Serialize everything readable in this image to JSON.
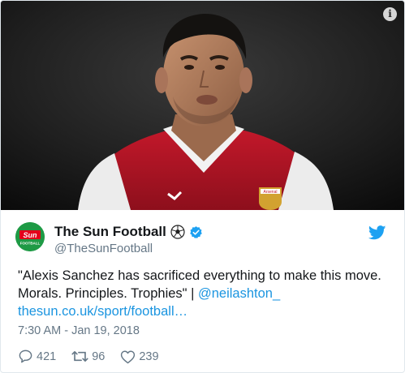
{
  "media": {
    "description_icon": "info-icon",
    "info_label": "i",
    "club_crest_text": "Arsenal"
  },
  "account": {
    "avatar_text": "Sun",
    "avatar_subtext": "FOOTBALL",
    "display_name": "The Sun Football",
    "name_emoji": "⚽",
    "handle": "@TheSunFootball",
    "verified": true
  },
  "tweet": {
    "text_line1": "\"Alexis Sanchez has sacrificed everything to make this move.",
    "text_line2_prefix": "Morals. Principles. Trophies\" | ",
    "mention": "@neilashton_",
    "link": "thesun.co.uk/sport/football…",
    "timestamp": "7:30 AM - Jan 19, 2018"
  },
  "actions": {
    "reply_count": "421",
    "retweet_count": "96",
    "like_count": "239"
  },
  "colors": {
    "link": "#1b95e0",
    "muted": "#657786",
    "text": "#14171a",
    "verified": "#1da1f2",
    "brand_green": "#1e9a45",
    "brand_red": "#e3001b"
  }
}
